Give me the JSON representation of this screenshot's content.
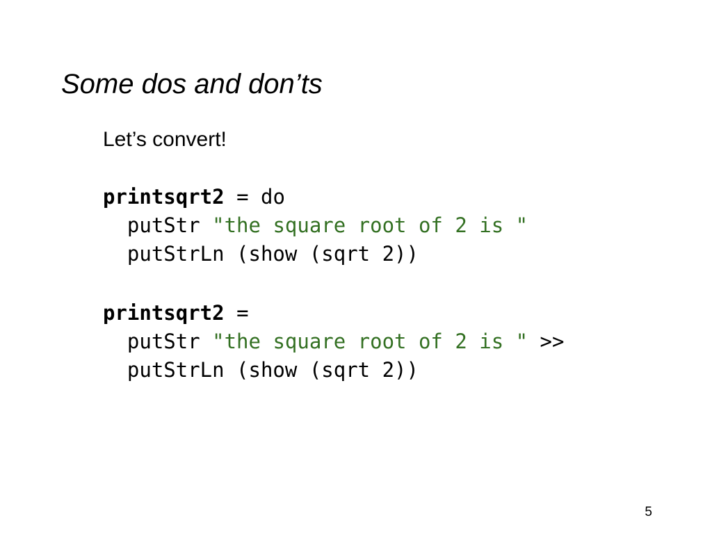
{
  "slide": {
    "title": "Some dos and don’ts",
    "page_number": "5",
    "background_color": "#ffffff",
    "text_color": "#000000",
    "string_literal_color": "#337022"
  },
  "body": {
    "lead_text": "Let’s convert!",
    "code_blocks": [
      {
        "name": "do-notation-version",
        "lines": [
          {
            "indent": "",
            "tokens": [
              {
                "kind": "bold",
                "text": "printsqrt2"
              },
              {
                "kind": "plain",
                "text": " = do"
              }
            ]
          },
          {
            "indent": "  ",
            "tokens": [
              {
                "kind": "plain",
                "text": "putStr "
              },
              {
                "kind": "string",
                "text": "\"the square root of 2 is \""
              }
            ]
          },
          {
            "indent": "  ",
            "tokens": [
              {
                "kind": "plain",
                "text": "putStrLn (show (sqrt 2))"
              }
            ]
          }
        ]
      },
      {
        "name": "bind-operator-version",
        "lines": [
          {
            "indent": "",
            "tokens": [
              {
                "kind": "bold",
                "text": "printsqrt2"
              },
              {
                "kind": "plain",
                "text": " ="
              }
            ]
          },
          {
            "indent": "  ",
            "tokens": [
              {
                "kind": "plain",
                "text": "putStr "
              },
              {
                "kind": "string",
                "text": "\"the square root of 2 is \""
              },
              {
                "kind": "plain",
                "text": " >>"
              }
            ]
          },
          {
            "indent": "  ",
            "tokens": [
              {
                "kind": "plain",
                "text": "putStrLn (show (sqrt 2))"
              }
            ]
          }
        ]
      }
    ]
  }
}
